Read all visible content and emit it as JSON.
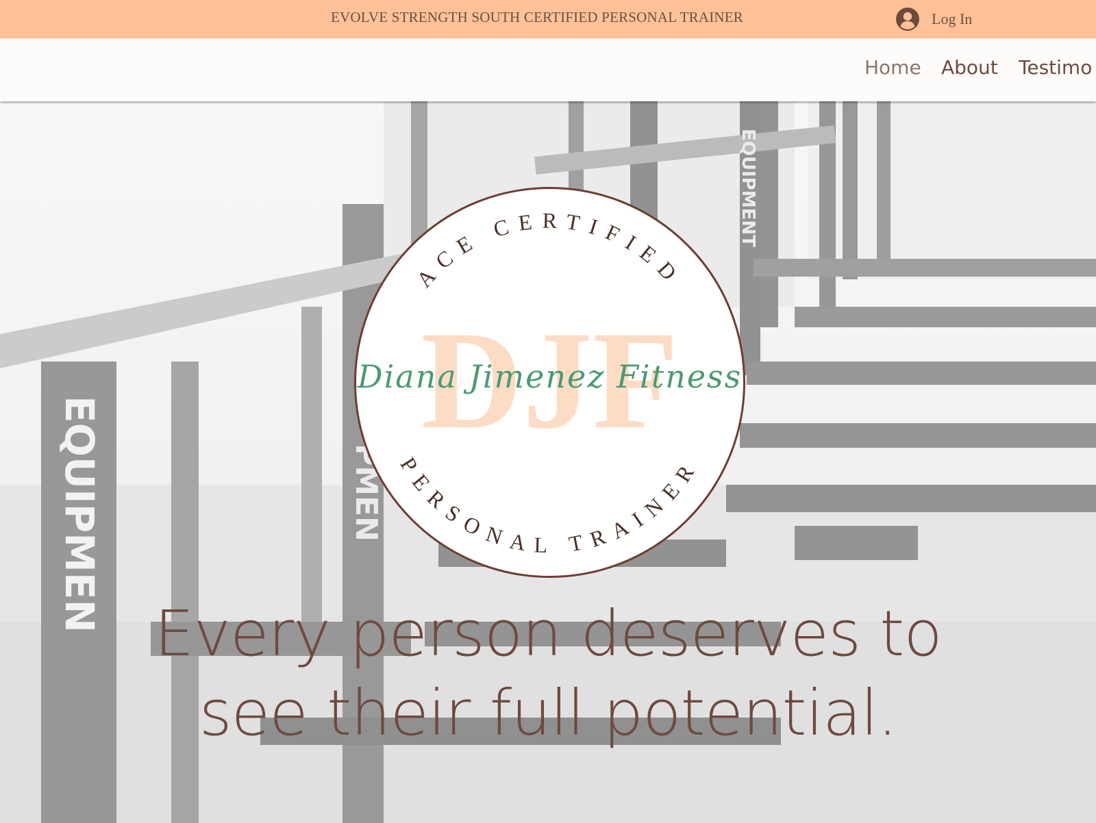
{
  "banner": {
    "text": "EVOLVE STRENGTH SOUTH CERTIFIED PERSONAL TRAINER",
    "login_label": "Log In",
    "background": "#fec198",
    "login_icon": "user-avatar-icon"
  },
  "nav": {
    "items": [
      {
        "label": "Home"
      },
      {
        "label": "About"
      },
      {
        "label": "Testimo"
      }
    ]
  },
  "logo": {
    "top_arc": "ACE CERTIFIED",
    "bottom_arc": "PERSONAL TRAINER",
    "monogram": "DJF",
    "script_text": "Diana Jimenez Fitness",
    "colors": {
      "ring": "#6e3d33",
      "monogram": "#fddcc6",
      "script": "#4a9a72"
    }
  },
  "hero": {
    "headline_line1": "Every person deserves to",
    "headline_line2": "see their full potential.",
    "text_color": "#6e4a3e"
  }
}
